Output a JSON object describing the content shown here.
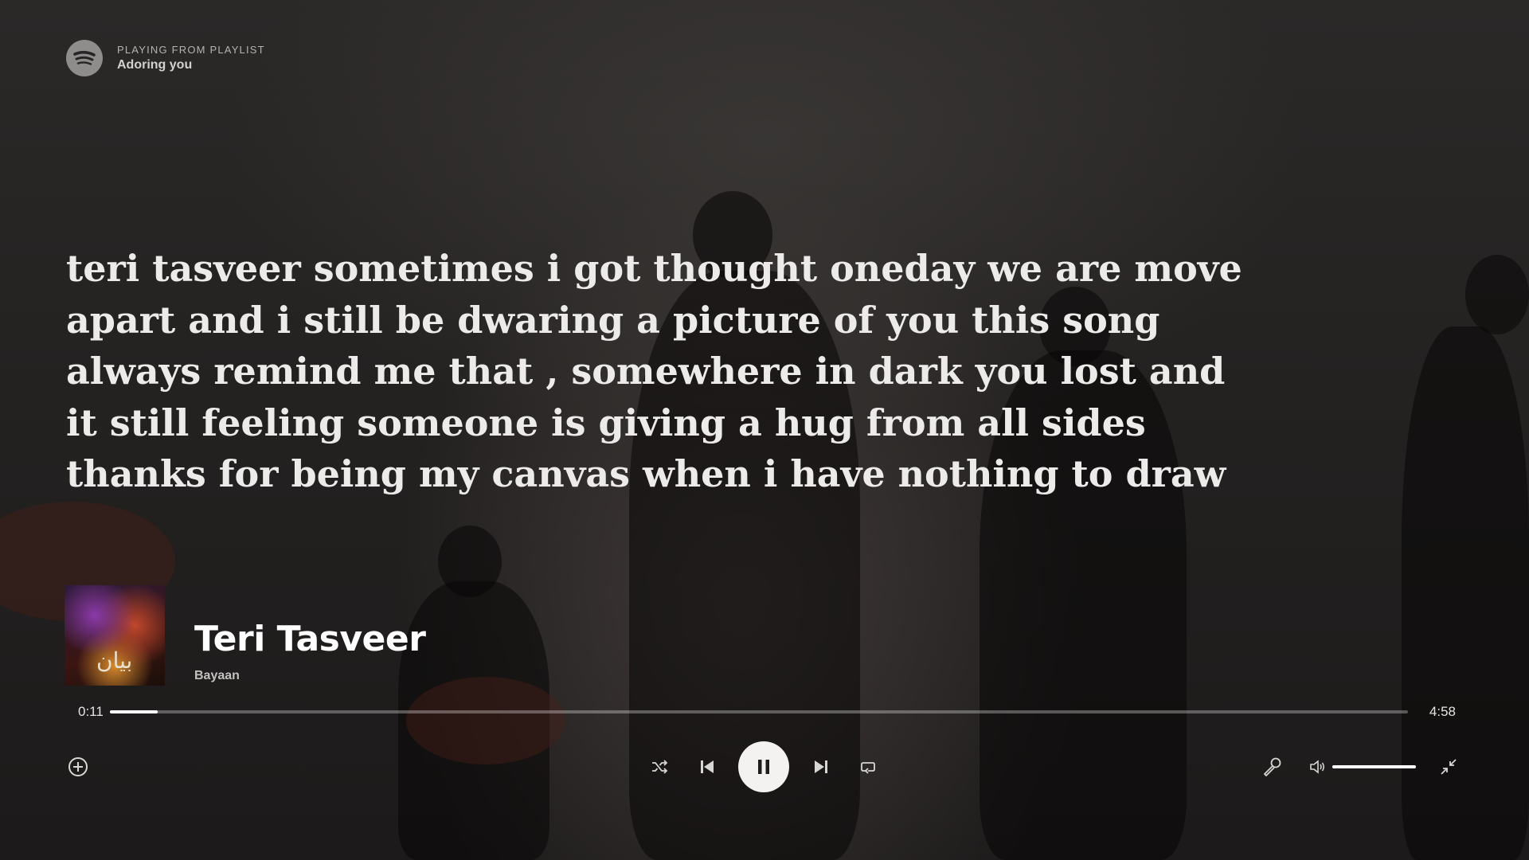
{
  "context": {
    "label": "PLAYING FROM PLAYLIST",
    "name": "Adoring you"
  },
  "lyrics": [
    "teri tasveer sometimes i got thought oneday we are move",
    "apart and i still be dwaring a picture of you this song",
    "always remind me that , somewhere in dark you lost and",
    "it still feeling someone is giving a hug from all sides",
    "thanks for being my canvas when i have nothing to draw"
  ],
  "track": {
    "title": "Teri Tasveer",
    "artist": "Bayaan",
    "cover_text": "بیان"
  },
  "playback": {
    "elapsed": "0:11",
    "duration": "4:58",
    "progress_fraction": 0.037,
    "volume_fraction": 1.0,
    "state": "playing"
  },
  "icons": {
    "logo": "spotify-icon",
    "add": "add-circle-icon",
    "shuffle": "shuffle-icon",
    "previous": "skip-previous-icon",
    "pause": "pause-icon",
    "next": "skip-next-icon",
    "repeat": "repeat-icon",
    "lyrics": "microphone-icon",
    "volume": "volume-icon",
    "exit_fullscreen": "minimize-icon"
  },
  "colors": {
    "background": "#242221",
    "lyric_text": "#ecebea",
    "progress_fill": "#ffffff"
  }
}
